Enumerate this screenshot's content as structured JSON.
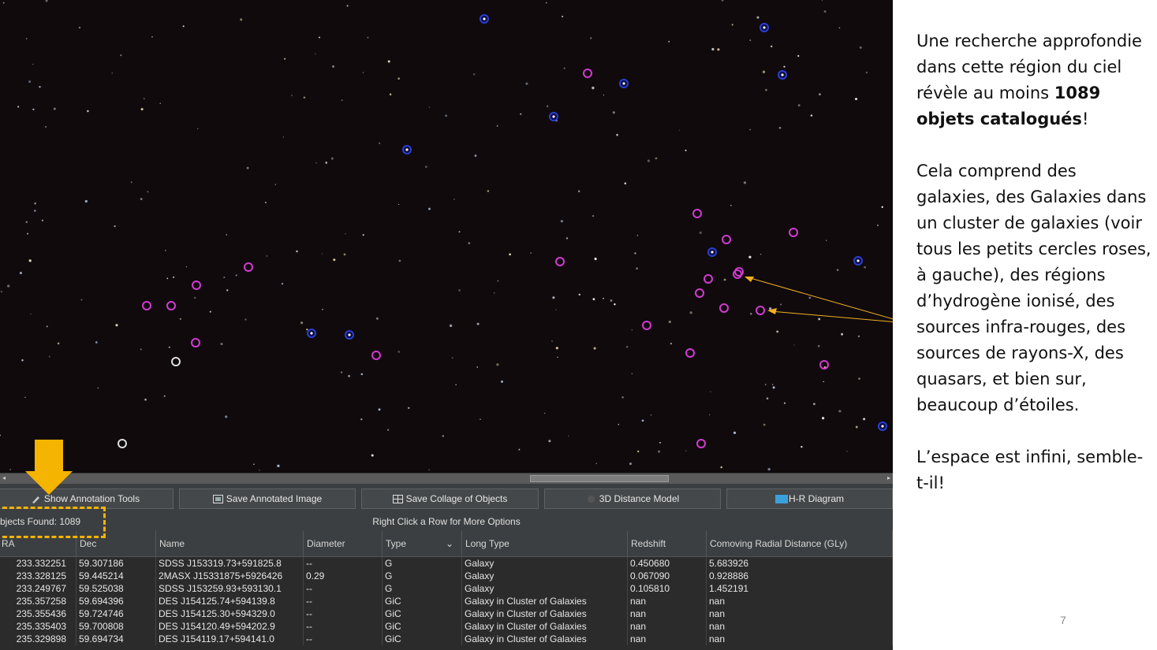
{
  "toolbar": {
    "buttons": [
      {
        "label": "Show Annotation Tools",
        "icon": "pencil-icon"
      },
      {
        "label": "Save Annotated Image",
        "icon": "image-icon"
      },
      {
        "label": "Save Collage of Objects",
        "icon": "grid-icon"
      },
      {
        "label": "3D Distance Model",
        "icon": "cube-icon"
      },
      {
        "label": "H-R Diagram",
        "icon": "chart-icon"
      }
    ]
  },
  "info": {
    "found": "bjects Found: 1089",
    "hint": "Right Click a Row for More Options"
  },
  "table": {
    "columns": [
      "RA",
      "Dec",
      "Name",
      "Diameter",
      "Type",
      "Long Type",
      "Redshift",
      "Comoving Radial Distance (GLy)"
    ],
    "rows": [
      [
        "233.332251",
        "59.307186",
        "SDSS J153319.73+591825.8",
        "--",
        "G",
        "Galaxy",
        "0.450680",
        "5.683926"
      ],
      [
        "233.328125",
        "59.445214",
        "2MASX J15331875+5926426",
        "0.29",
        "G",
        "Galaxy",
        "0.067090",
        "0.928886"
      ],
      [
        "233.249767",
        "59.525038",
        "SDSS J153259.93+593130.1",
        "--",
        "G",
        "Galaxy",
        "0.105810",
        "1.452191"
      ],
      [
        "235.357258",
        "59.694396",
        "DES J154125.74+594139.8",
        "--",
        "GiC",
        "Galaxy in Cluster of Galaxies",
        "nan",
        "nan"
      ],
      [
        "235.355436",
        "59.724746",
        "DES J154125.30+594329.0",
        "--",
        "GiC",
        "Galaxy in Cluster of Galaxies",
        "nan",
        "nan"
      ],
      [
        "235.335403",
        "59.700808",
        "DES J154120.49+594202.9",
        "--",
        "GiC",
        "Galaxy in Cluster of Galaxies",
        "nan",
        "nan"
      ],
      [
        "235.329898",
        "59.694734",
        "DES J154119.17+594141.0",
        "--",
        "GiC",
        "Galaxy in Cluster of Galaxies",
        "nan",
        "nan"
      ]
    ]
  },
  "sidebar": {
    "p1_a": "Une recherche approfondie dans cette région du ciel révèle au moins ",
    "p1_b": "1089 objets catalogués",
    "p1_c": "!",
    "p2": "Cela comprend des galaxies, des Galaxies dans un cluster de galaxies (voir tous les petits cercles roses, à gauche), des régions d’hydrogène ionisé, des sources infra-rouges, des sources de rayons-X, des quasars, et bien sur, beaucoup d’étoiles.",
    "p3": "L’espace est infini, semble-t-il!"
  },
  "page_number": "7",
  "colors": {
    "sky": "#100a0d",
    "galaxy_marker": "#d23ad2",
    "star_marker": "#2a3fd6",
    "highlight": "#f5b400",
    "pointer_line": "#f0b020"
  }
}
